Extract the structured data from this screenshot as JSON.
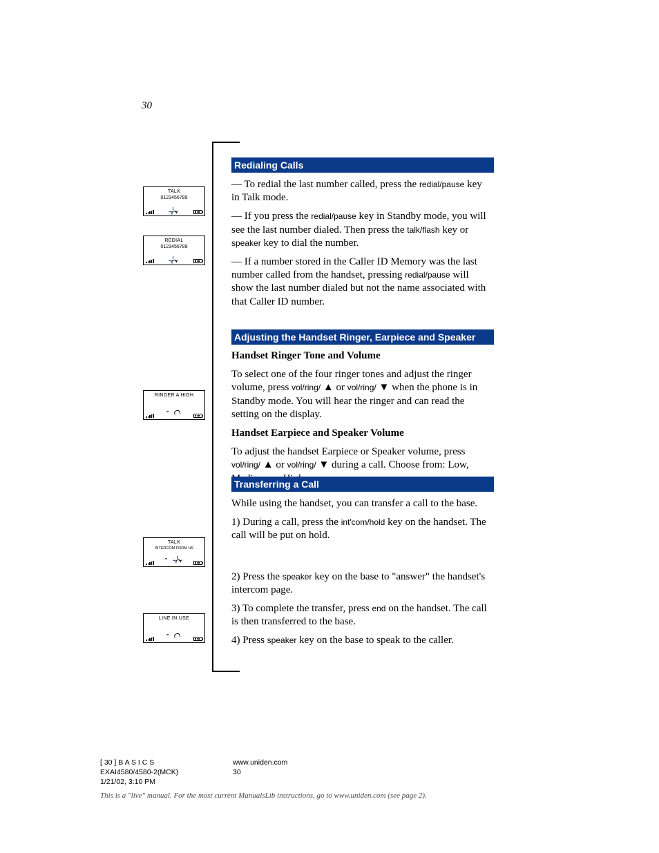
{
  "page_number": "30",
  "sections": {
    "redial": {
      "title": "Redialing Calls",
      "p1_a": "— To redial the last number called, press the ",
      "p1_key": "redial/pause",
      "p1_b": " key in Talk mode.",
      "p2_a": "— If you press the ",
      "p2_key": "redial/pause",
      "p2_b": " key in Standby mode, you will see the last number dialed. Then press the ",
      "p2_key2": "talk/flash",
      "p2_c": " key or ",
      "p2_key3": "speaker",
      "p2_d": " key to dial the number.",
      "p3_a": "— If a number stored in the Caller ID Memory was the last number called from the handset, pressing ",
      "p3_key": "redial/pause",
      "p3_b": " will show the last number dialed but not the name associated with that Caller ID number."
    },
    "volume": {
      "title": "Adjusting the Handset Ringer, Earpiece and Speaker Volume",
      "ringer_label": "Handset Ringer Tone and Volume",
      "ringer_body_a": "To select one of the four ringer tones and adjust the ringer volume, press ",
      "ringer_key1": "vol/ring/",
      "ringer_body_b": " or ",
      "ringer_key2": "vol/ring/",
      "ringer_body_c": " when the phone is in Standby mode. You will hear the ringer and can read the setting on the display.",
      "ear_label": "Handset Earpiece and Speaker Volume",
      "ear_body_a": "To adjust the handset Earpiece or Speaker volume, press ",
      "ear_key1": "vol/ring/",
      "ear_body_b": " or ",
      "ear_key2": "vol/ring/",
      "ear_body_c": " during a call. Choose from: Low, Medium, or High."
    },
    "transfer": {
      "title": "Transferring a Call",
      "intro": "While using the handset, you can transfer a call to the base.",
      "step1_a": "1) During a call, press the ",
      "step1_key": "int'com/hold",
      "step1_b": " key on the handset. The call will be put on hold.",
      "step2_a": "2) Press the ",
      "step2_key": "speaker",
      "step2_b": " key on the base to \"answer\" the handset's intercom page.",
      "step3_a": "3) To complete the transfer, press ",
      "step3_key": "end",
      "step3_b": " on the handset. The call is then transferred to the base.",
      "step4_a": "4) Press ",
      "step4_key": "speaker",
      "step4_b": " key on the base to speak to the caller."
    }
  },
  "mocks": {
    "m1": {
      "title": "TALK",
      "line2": "0123456789"
    },
    "m2": {
      "title": "REDIAL",
      "line2": "0123456789"
    },
    "m3": {
      "title": "RINGER A HIGH"
    },
    "m4": {
      "title": "TALK",
      "line2": "INTERCOM FROM HS"
    },
    "m5": {
      "title": "LINE IN USE"
    }
  },
  "footer": {
    "left": {
      "l1": "[ 30 ] B A S I C S",
      "l2": "EXAI4580/4580-2(MCK)",
      "l3": "1/21/02, 3:10 PM"
    },
    "mid": {
      "l1": "www.uniden.com",
      "l2": "30"
    },
    "hint": "This is a \"live\" manual. For the most current ManualsLib instructions, go to www.uniden.com (see page 2)."
  }
}
